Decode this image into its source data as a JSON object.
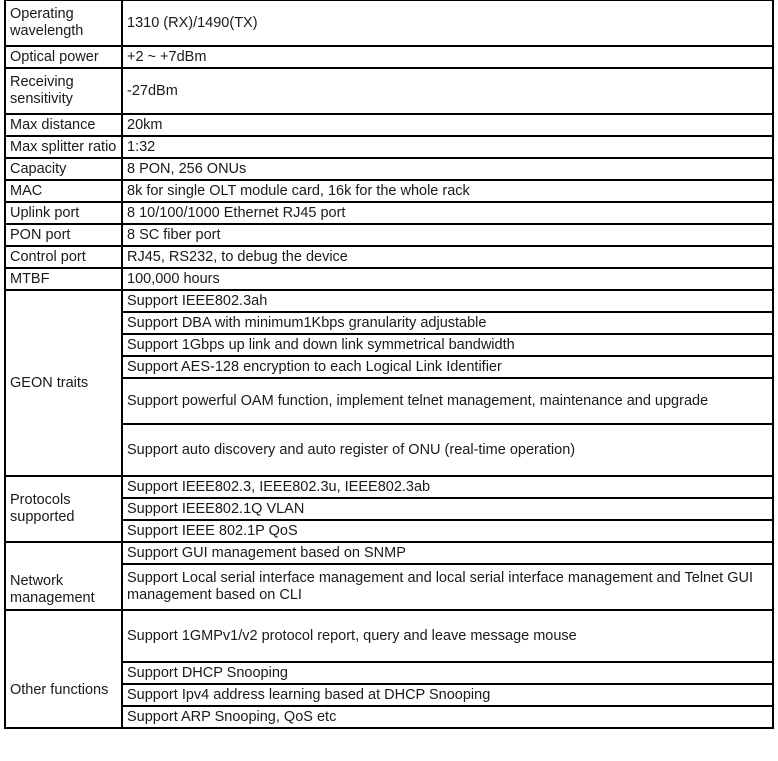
{
  "document": {
    "type": "specification-table",
    "column_count": 2
  },
  "rows": [
    {
      "label": "Operating wavelength",
      "label_lines": [
        "Operating",
        "wavelength"
      ],
      "values": [
        "1310 (RX)/1490(TX)"
      ],
      "height": "double"
    },
    {
      "label": "Optical power",
      "label_lines": [
        "Optical power"
      ],
      "values": [
        "+2 ~ +7dBm"
      ],
      "height": "single"
    },
    {
      "label": "Receiving sensitivity",
      "label_lines": [
        "Receiving",
        "sensitivity"
      ],
      "values": [
        "-27dBm"
      ],
      "height": "double"
    },
    {
      "label": "Max distance",
      "label_lines": [
        "Max distance"
      ],
      "values": [
        "20km"
      ],
      "height": "single"
    },
    {
      "label": "Max splitter ratio",
      "label_lines": [
        "Max splitter ratio"
      ],
      "values": [
        "1:32"
      ],
      "height": "single"
    },
    {
      "label": "Capacity",
      "label_lines": [
        "Capacity"
      ],
      "values": [
        "8 PON, 256 ONUs"
      ],
      "height": "single"
    },
    {
      "label": "MAC",
      "label_lines": [
        "MAC"
      ],
      "values": [
        "8k for single OLT module card, 16k for the whole rack"
      ],
      "height": "single"
    },
    {
      "label": "Uplink port",
      "label_lines": [
        "Uplink port"
      ],
      "values": [
        "8 10/100/1000 Ethernet RJ45 port"
      ],
      "height": "single"
    },
    {
      "label": "PON port",
      "label_lines": [
        "PON port"
      ],
      "values": [
        "8 SC fiber port"
      ],
      "height": "single"
    },
    {
      "label": "Control port",
      "label_lines": [
        "Control port"
      ],
      "values": [
        "RJ45, RS232, to debug the device"
      ],
      "height": "single"
    },
    {
      "label": "MTBF",
      "label_lines": [
        "MTBF"
      ],
      "values": [
        "100,000 hours"
      ],
      "height": "single"
    },
    {
      "label": "GEON traits",
      "label_lines": [
        "GEON traits"
      ],
      "values": [
        "Support IEEE802.3ah",
        "Support DBA with minimum1Kbps granularity adjustable",
        "Support 1Gbps up link and down link symmetrical bandwidth",
        "Support AES-128 encryption to each Logical Link Identifier",
        "Support powerful OAM function, implement telnet management, maintenance and upgrade",
        "Support auto discovery and auto register of ONU (real-time operation)"
      ],
      "height": "group"
    },
    {
      "label": "Protocols supported",
      "label_lines": [
        "Protocols",
        "supported"
      ],
      "values": [
        "Support IEEE802.3, IEEE802.3u, IEEE802.3ab",
        "Support IEEE802.1Q VLAN",
        "Support IEEE 802.1P QoS"
      ],
      "height": "group"
    },
    {
      "label": "Network management",
      "label_lines": [
        "Network",
        "management"
      ],
      "values": [
        "Support GUI management based on SNMP",
        "Support Local serial interface management and local serial interface management and Telnet GUI management based on CLI"
      ],
      "height": "group"
    },
    {
      "label": "Other functions",
      "label_lines": [
        "Other functions"
      ],
      "values": [
        "Support 1GMPv1/v2 protocol report, query and leave message mouse",
        "Support DHCP Snooping",
        "Support Ipv4 address learning based at DHCP Snooping",
        "Support ARP Snooping, QoS etc"
      ],
      "height": "group"
    }
  ],
  "cells": {
    "operating_wavelength_label": "Operating wavelength",
    "operating_wavelength_value": "1310 (RX)/1490(TX)",
    "optical_power_label": "Optical power",
    "optical_power_value": "+2 ~ +7dBm",
    "receiving_sensitivity_label": "Receiving sensitivity",
    "receiving_sensitivity_value": "-27dBm",
    "max_distance_label": "Max distance",
    "max_distance_value": "20km",
    "max_splitter_ratio_label": "Max splitter ratio",
    "max_splitter_ratio_value": "1:32",
    "capacity_label": "Capacity",
    "capacity_value": "8 PON, 256 ONUs",
    "mac_label": "MAC",
    "mac_value": "8k for single OLT module card, 16k for the whole rack",
    "uplink_port_label": "Uplink port",
    "uplink_port_value": "8 10/100/1000 Ethernet RJ45 port",
    "pon_port_label": "PON port",
    "pon_port_value": "8 SC fiber port",
    "control_port_label": "Control port",
    "control_port_value": "RJ45, RS232, to debug the device",
    "mtbf_label": "MTBF",
    "mtbf_value": "100,000 hours",
    "geon_traits_label": "GEON traits",
    "geon_1": "Support IEEE802.3ah",
    "geon_2": "Support DBA with minimum1Kbps granularity adjustable",
    "geon_3": "Support 1Gbps up link and down link symmetrical bandwidth",
    "geon_4": "Support AES-128 encryption to each Logical Link Identifier",
    "geon_5": "Support powerful OAM function, implement telnet management, maintenance and upgrade",
    "geon_6": "Support auto discovery and auto register of ONU (real-time operation)",
    "protocols_label": "Protocols supported",
    "protocols_1": "Support IEEE802.3, IEEE802.3u, IEEE802.3ab",
    "protocols_2": "Support IEEE802.1Q VLAN",
    "protocols_3": "Support IEEE 802.1P QoS",
    "network_mgmt_label": "Network management",
    "network_mgmt_1": "Support GUI management based on SNMP",
    "network_mgmt_2": "Support Local serial interface management and local serial interface management and Telnet GUI management based on CLI",
    "other_functions_label": "Other functions",
    "other_1": "Support 1GMPv1/v2 protocol report, query and leave message mouse",
    "other_2": "Support DHCP Snooping",
    "other_3": "Support Ipv4 address learning based at DHCP Snooping",
    "other_4": "Support ARP Snooping, QoS etc"
  },
  "colors": {
    "border": "#000000",
    "text": "#1a1a1a",
    "background": "#ffffff"
  }
}
